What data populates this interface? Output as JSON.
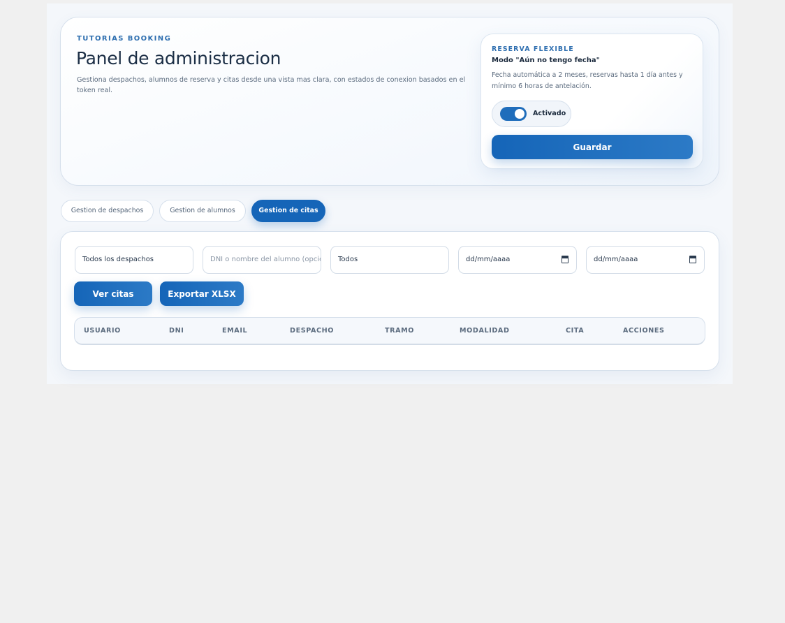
{
  "header": {
    "eyebrow": "TUTORIAS BOOKING",
    "title": "Panel de administracion",
    "description": "Gestiona despachos, alumnos de reserva y citas desde una vista mas clara, con estados de conexion basados en el token real."
  },
  "flexible": {
    "eyebrow": "RESERVA FLEXIBLE",
    "mode": "Modo \"Aún no tengo fecha\"",
    "description": "Fecha automática a 2 meses, reservas hasta 1 día antes y mínimo 6 horas de antelación.",
    "toggle_label": "Activado",
    "toggle_on": true,
    "save_label": "Guardar"
  },
  "tabs": [
    {
      "label": "Gestion de despachos",
      "active": false
    },
    {
      "label": "Gestion de alumnos",
      "active": false
    },
    {
      "label": "Gestion de citas",
      "active": true
    }
  ],
  "filters": {
    "office_select": "Todos los despachos",
    "student_placeholder": "DNI o nombre del alumno (opcional)",
    "status_select": "Todos",
    "date_from": "dd/mm/aaaa",
    "date_to": "dd/mm/aaaa"
  },
  "actions": {
    "view_label": "Ver citas",
    "export_label": "Exportar XLSX"
  },
  "table": {
    "columns": [
      "USUARIO",
      "DNI",
      "EMAIL",
      "DESPACHO",
      "TRAMO",
      "MODALIDAD",
      "CITA",
      "ACCIONES"
    ]
  },
  "colors": {
    "accent": "#1565b8",
    "eyebrow": "#2f6fb0",
    "background": "#f0f0f0"
  }
}
